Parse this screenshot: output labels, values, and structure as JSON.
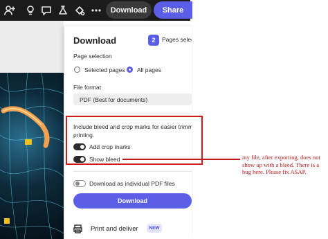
{
  "toolbar": {
    "icons": [
      "add-person-icon",
      "lightbulb-icon",
      "comment-icon",
      "flask-icon",
      "fill-settings-icon",
      "more-icon"
    ],
    "download_label": "Download",
    "share_label": "Share"
  },
  "panel": {
    "title": "Download",
    "pages_count": "2",
    "pages_selected_label": "Pages selected",
    "page_selection_heading": "Page selection",
    "page_selection_options": [
      {
        "label": "Selected pages",
        "checked": false
      },
      {
        "label": "All pages",
        "checked": true
      }
    ],
    "file_format_heading": "File format",
    "file_format_value": "PDF (Best for documents)",
    "bleed_description_line1": "Include bleed and crop marks for easier trimming a",
    "bleed_description_line2": "printing.",
    "add_crop_marks_label": "Add crop marks",
    "add_crop_marks_on": true,
    "show_bleed_label": "Show bleed",
    "show_bleed_on": true,
    "individual_pdf_label": "Download as individual PDF files",
    "individual_pdf_on": false,
    "download_button_label": "Download",
    "print_deliver_label": "Print and deliver",
    "new_badge": "NEW"
  },
  "annotation": {
    "note": "my file, after exporting, does not show up with a bleed. There is a bug here. Please fix ASAP.",
    "color": "#c01818"
  }
}
